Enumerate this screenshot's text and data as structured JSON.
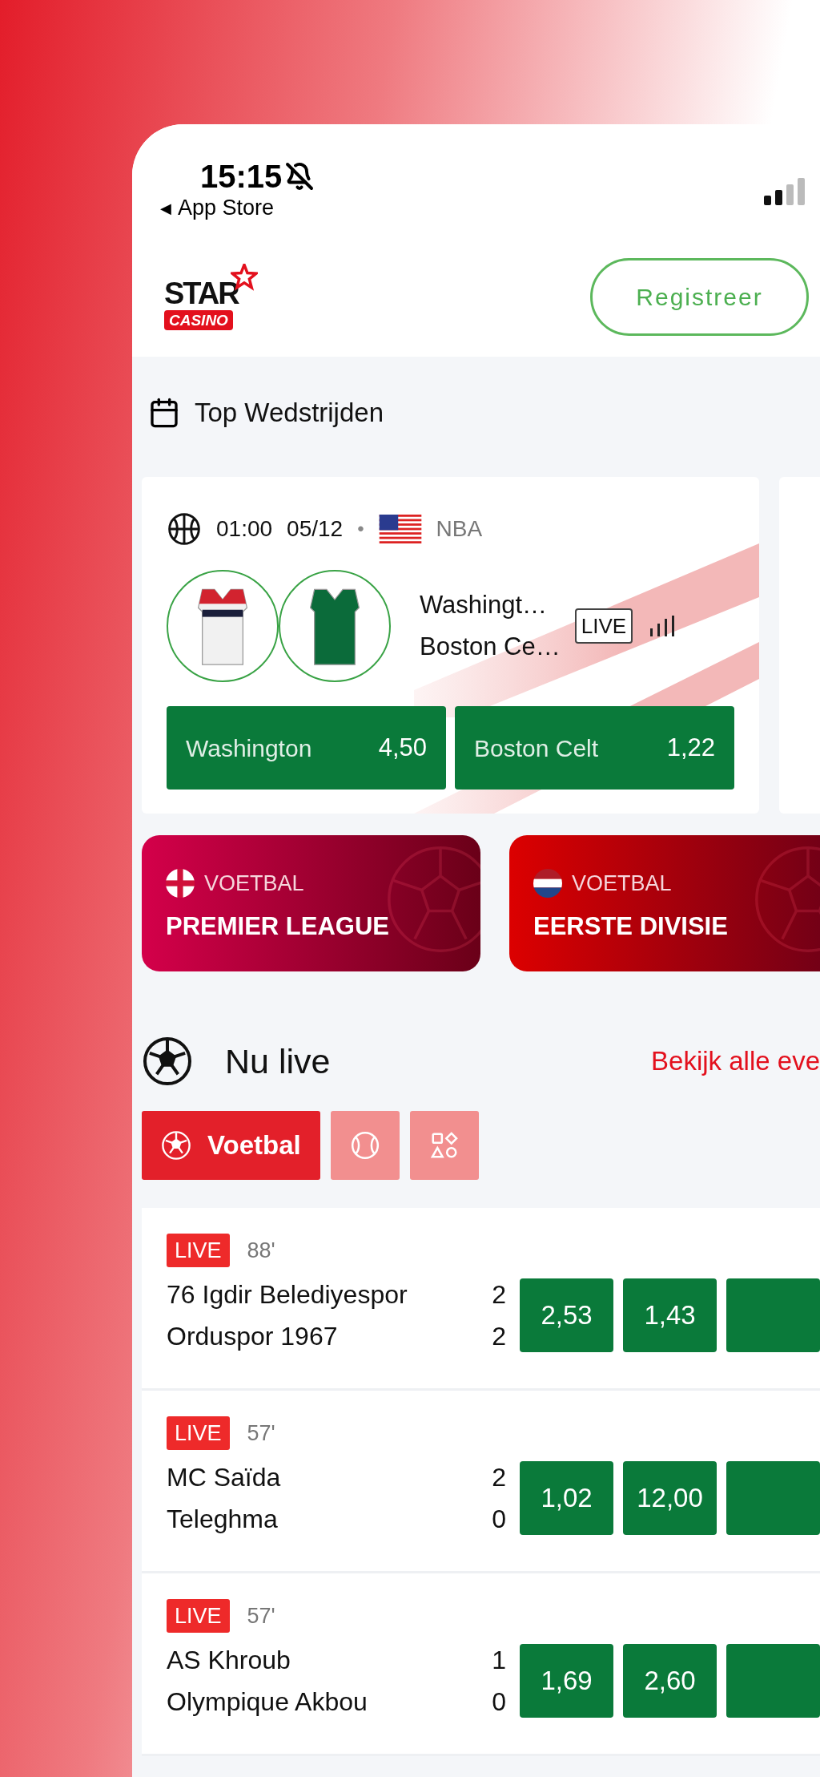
{
  "status_bar": {
    "time": "15:15",
    "back_arrow": "◀",
    "back_label": "App Store"
  },
  "header": {
    "logo_top": "STAR",
    "logo_bottom": "CASINO",
    "register_button": "Registreer"
  },
  "top_matches": {
    "title": "Top Wedstrijden",
    "matches": [
      {
        "time": "01:00",
        "date": "05/12",
        "separator": "•",
        "league": "NBA",
        "home": "Washingt…",
        "away": "Boston Ce…",
        "live_badge": "LIVE",
        "odds": [
          {
            "label": "Washington",
            "value": "4,50"
          },
          {
            "label": "Boston Celt",
            "value": "1,22"
          }
        ]
      }
    ]
  },
  "banners": [
    {
      "kind": "england",
      "sport": "VOETBAL",
      "league": "PREMIER LEAGUE",
      "color": "#d4004a"
    },
    {
      "kind": "netherlands",
      "sport": "VOETBAL",
      "league": "EERSTE DIVISIE",
      "color": "#dc0000"
    }
  ],
  "live": {
    "title": "Nu live",
    "link": "Bekijk alle eve",
    "filters": [
      {
        "kind": "football",
        "label": "Voetbal",
        "selected": true
      },
      {
        "kind": "tennis",
        "selected": false
      },
      {
        "kind": "other",
        "selected": false
      }
    ],
    "matches": [
      {
        "badge": "LIVE",
        "minute": "88'",
        "home": "76 Igdir Belediyespor",
        "away": "Orduspor 1967",
        "home_score": "2",
        "away_score": "2",
        "odds": [
          "2,53",
          "1,43"
        ]
      },
      {
        "badge": "LIVE",
        "minute": "57'",
        "home": "MC Saïda",
        "away": "Teleghma",
        "home_score": "2",
        "away_score": "0",
        "odds": [
          "1,02",
          "12,00"
        ]
      },
      {
        "badge": "LIVE",
        "minute": "57'",
        "home": "AS Khroub",
        "away": "Olympique Akbou",
        "home_score": "1",
        "away_score": "0",
        "odds": [
          "1,69",
          "2,60"
        ]
      }
    ]
  }
}
